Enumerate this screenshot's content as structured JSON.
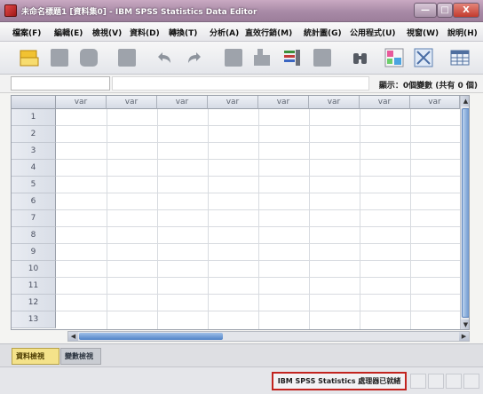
{
  "window": {
    "title": "未命名標題1 [資料集0] - IBM SPSS Statistics Data Editor",
    "minimize_label": "—",
    "maximize_label": "□",
    "close_label": "X"
  },
  "menu": [
    {
      "label": "檔案(F)"
    },
    {
      "label": "編輯(E)"
    },
    {
      "label": "檢視(V)"
    },
    {
      "label": "資料(D)"
    },
    {
      "label": "轉換(T)"
    },
    {
      "label": "分析(A)"
    },
    {
      "label": "直效行銷(M)"
    },
    {
      "label": "統計圖(G)"
    },
    {
      "label": "公用程式(U)"
    },
    {
      "label": "視窗(W)"
    },
    {
      "label": "說明(H)"
    }
  ],
  "toolbar": [
    {
      "icon": "open-folder-icon"
    },
    {
      "icon": "save-icon"
    },
    {
      "icon": "print-icon"
    },
    {
      "icon": "dialog-recall-icon"
    },
    {
      "icon": "undo-icon"
    },
    {
      "icon": "redo-icon"
    },
    {
      "icon": "goto-case-icon"
    },
    {
      "icon": "goto-variable-icon"
    },
    {
      "icon": "variables-icon"
    },
    {
      "icon": "run-descriptive-icon"
    },
    {
      "icon": "find-icon"
    },
    {
      "icon": "insert-cases-icon"
    },
    {
      "icon": "insert-variable-icon"
    },
    {
      "icon": "split-file-icon"
    }
  ],
  "cellbar": {
    "reference": "",
    "value": "",
    "variable_count": "顯示：0個變數 (共有 0 個)"
  },
  "grid": {
    "columns": [
      "var",
      "var",
      "var",
      "var",
      "var",
      "var",
      "var",
      "var"
    ],
    "rows": [
      "1",
      "2",
      "3",
      "4",
      "5",
      "6",
      "7",
      "8",
      "9",
      "10",
      "11",
      "12",
      "13"
    ]
  },
  "tabs": {
    "data_view": "資料檢視",
    "variable_view": "變數檢視"
  },
  "status": {
    "message": "IBM SPSS Statistics 處理器已就緒"
  }
}
